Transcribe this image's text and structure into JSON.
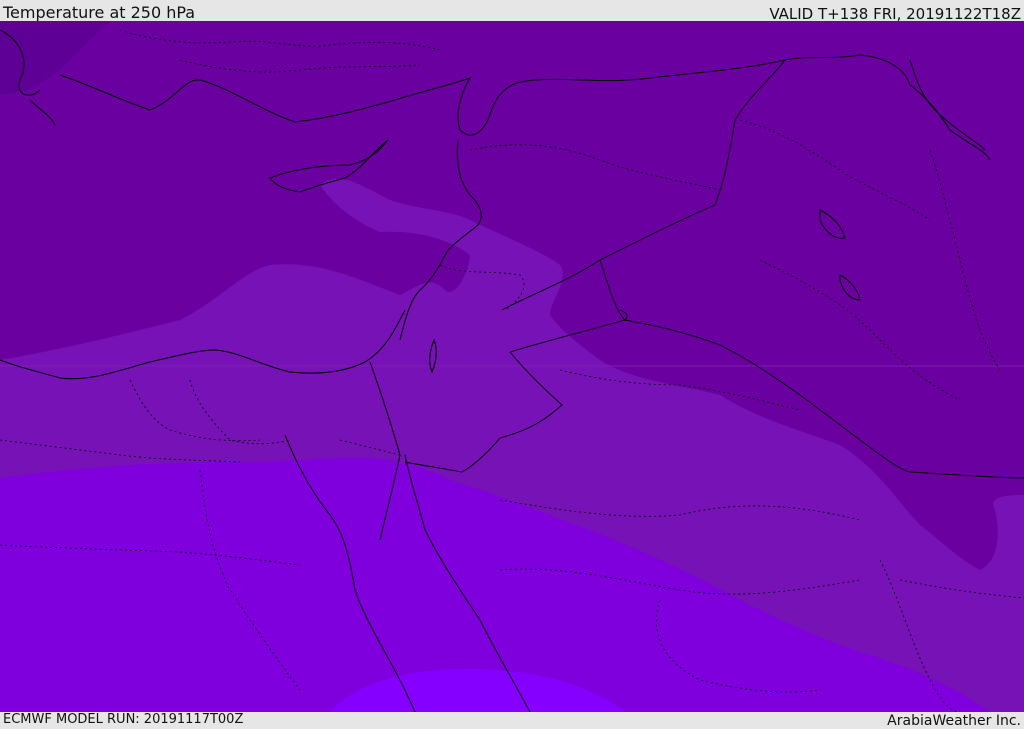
{
  "header": {
    "title": "Temperature at 250 hPa",
    "valid_time": "VALID T+138 FRI, 20191122T18Z"
  },
  "footer": {
    "model_run": "ECMWF MODEL RUN: 20191117T00Z",
    "credit": "ArabiaWeather Inc."
  },
  "map": {
    "variable": "temperature",
    "level": "250 hPa",
    "region": "Eastern Mediterranean and Middle East",
    "colors": {
      "coldest_band": "#63009a",
      "cold_band": "#6a00a0",
      "mid_band": "#7410b8",
      "warm_band": "#7e00dc",
      "warmest_band": "#8800ff",
      "border_line": "#000000"
    }
  }
}
